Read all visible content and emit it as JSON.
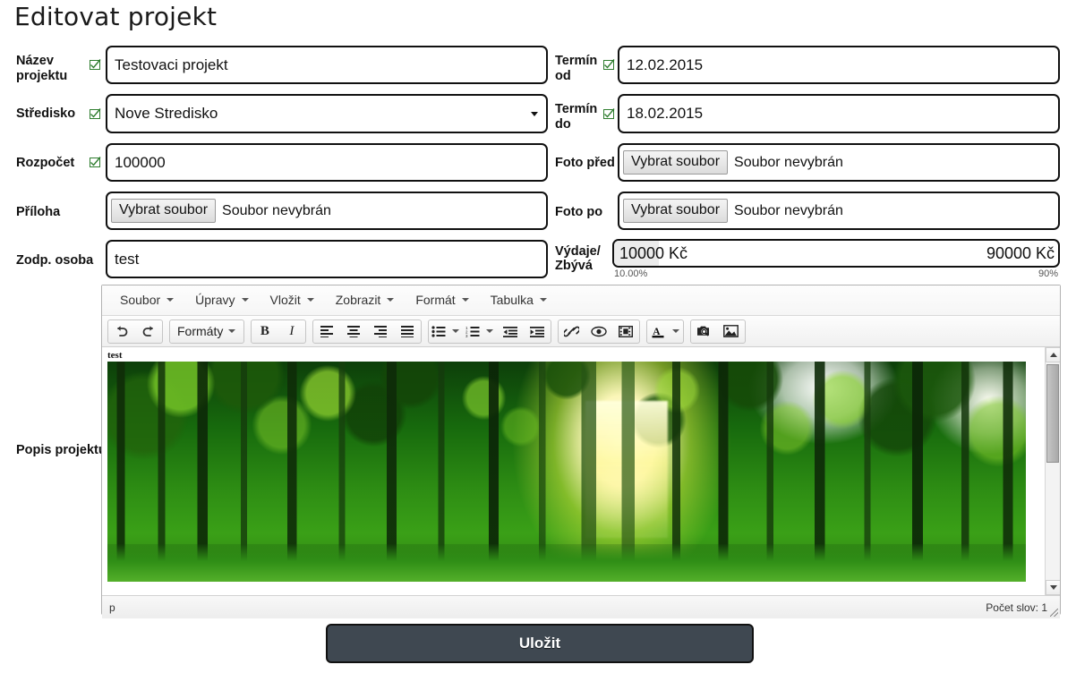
{
  "page": {
    "title": "Editovat projekt"
  },
  "form": {
    "left": [
      {
        "label": "Název projektu",
        "value": "Testovaci projekt",
        "kind": "text",
        "valid": true
      },
      {
        "label": "Středisko",
        "value": "Nove Stredisko",
        "kind": "select",
        "valid": true
      },
      {
        "label": "Rozpočet",
        "value": "100000",
        "kind": "text",
        "valid": true
      },
      {
        "label": "Příloha",
        "value": "",
        "kind": "file",
        "valid": false,
        "button": "Vybrat soubor",
        "status": "Soubor nevybrán"
      },
      {
        "label": "Zodp. osoba",
        "value": "test",
        "kind": "text",
        "valid": false
      }
    ],
    "right": [
      {
        "label": "Termín od",
        "value": "12.02.2015",
        "kind": "text",
        "valid": true
      },
      {
        "label": "Termín do",
        "value": "18.02.2015",
        "kind": "text",
        "valid": true
      },
      {
        "label": "Foto před",
        "value": "",
        "kind": "file",
        "valid": false,
        "button": "Vybrat soubor",
        "status": "Soubor nevybrán"
      },
      {
        "label": "Foto po",
        "value": "",
        "kind": "file",
        "valid": false,
        "button": "Vybrat soubor",
        "status": "Soubor nevybrán"
      }
    ],
    "budget": {
      "label": "Výdaje/ Zbývá",
      "label_line1": "Výdaje/",
      "label_line2": "Zbývá",
      "spent": "10000 Kč",
      "remaining": "90000 Kč",
      "spent_percent_text": "10.00%",
      "remaining_percent_text": "90%",
      "spent_percent": 10,
      "fill_color": "#ececec"
    },
    "description": {
      "label": "Popis projektu"
    },
    "save_label": "Uložit",
    "save_color": "#3f4851"
  },
  "editor": {
    "menubar": [
      {
        "label": "Soubor"
      },
      {
        "label": "Úpravy"
      },
      {
        "label": "Vložit"
      },
      {
        "label": "Zobrazit"
      },
      {
        "label": "Formát"
      },
      {
        "label": "Tabulka"
      }
    ],
    "toolbar": {
      "formats_label": "Formáty",
      "buttons": [
        "undo-icon",
        "redo-icon",
        "formats-dropdown",
        "bold-icon",
        "italic-icon",
        "align-left-icon",
        "align-center-icon",
        "align-right-icon",
        "align-justify-icon",
        "bullet-list-icon",
        "numbered-list-icon",
        "outdent-icon",
        "indent-icon",
        "link-icon",
        "preview-icon",
        "media-icon",
        "text-color-icon",
        "image-browse-icon",
        "image-icon"
      ]
    },
    "content": {
      "text": "test",
      "image_alt": "forest park with sunlight through trees"
    },
    "status": {
      "path": "p",
      "word_count": "Počet slov: 1"
    }
  }
}
